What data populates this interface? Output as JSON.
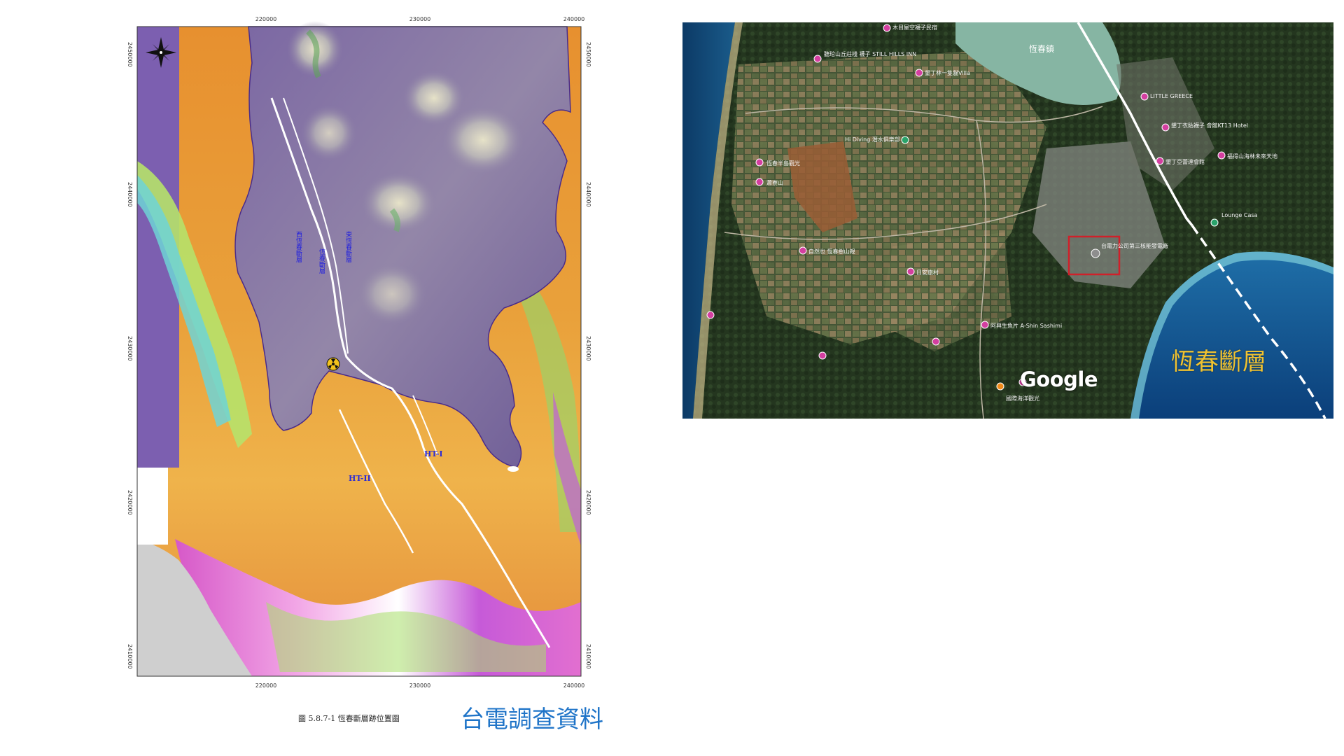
{
  "relief_map": {
    "x_ticks": [
      "220000",
      "230000",
      "240000"
    ],
    "y_ticks": [
      "2450000",
      "2440000",
      "2430000",
      "2420000",
      "2410000"
    ],
    "fault_labels": {
      "west": "西恆春斷層",
      "main": "恆春斷層",
      "east": "東恆春斷層"
    },
    "offshore_faults": [
      "HT-I",
      "HT-II"
    ],
    "caption": "圖 5.8.7-1   恆春斷層跡位置圖",
    "source_label": "台電調查資料",
    "icons": [
      "compass-rose-icon",
      "nuclear-plant-icon"
    ]
  },
  "satellite_map": {
    "town": "恆春鎮",
    "pois": [
      "木目屋空襪子民宿",
      "聽琯山丘莊棧 襪子 STILL HILLS INN",
      "墾丁林一隻貓Villa",
      "LITTLE GREECE",
      "墾丁衣貼襪子 會館KT13 Hotel",
      "墾丁亞蕾達會館",
      "福得山海林未來天地",
      "Hi Diving 潛水俱樂部",
      "Lounge Casa",
      "台電力公司第三核能發電廠",
      "蕭寮山",
      "恆春半島觀光",
      "自然也 恆春樹山親",
      "日安旅村",
      "阿興生魚片 A-Shin Sashimi",
      "國際海洋觀光",
      "Google"
    ],
    "google_logo": "Google",
    "fault_label": "恆春斷層",
    "colors": {
      "fault_line": "#ffffff",
      "plant_box": "#d0202a",
      "fault_label": "#f0c230",
      "poi_pin": "#d43fa0"
    },
    "icons": [
      "location-pin-icon",
      "plant-marker-icon"
    ]
  }
}
